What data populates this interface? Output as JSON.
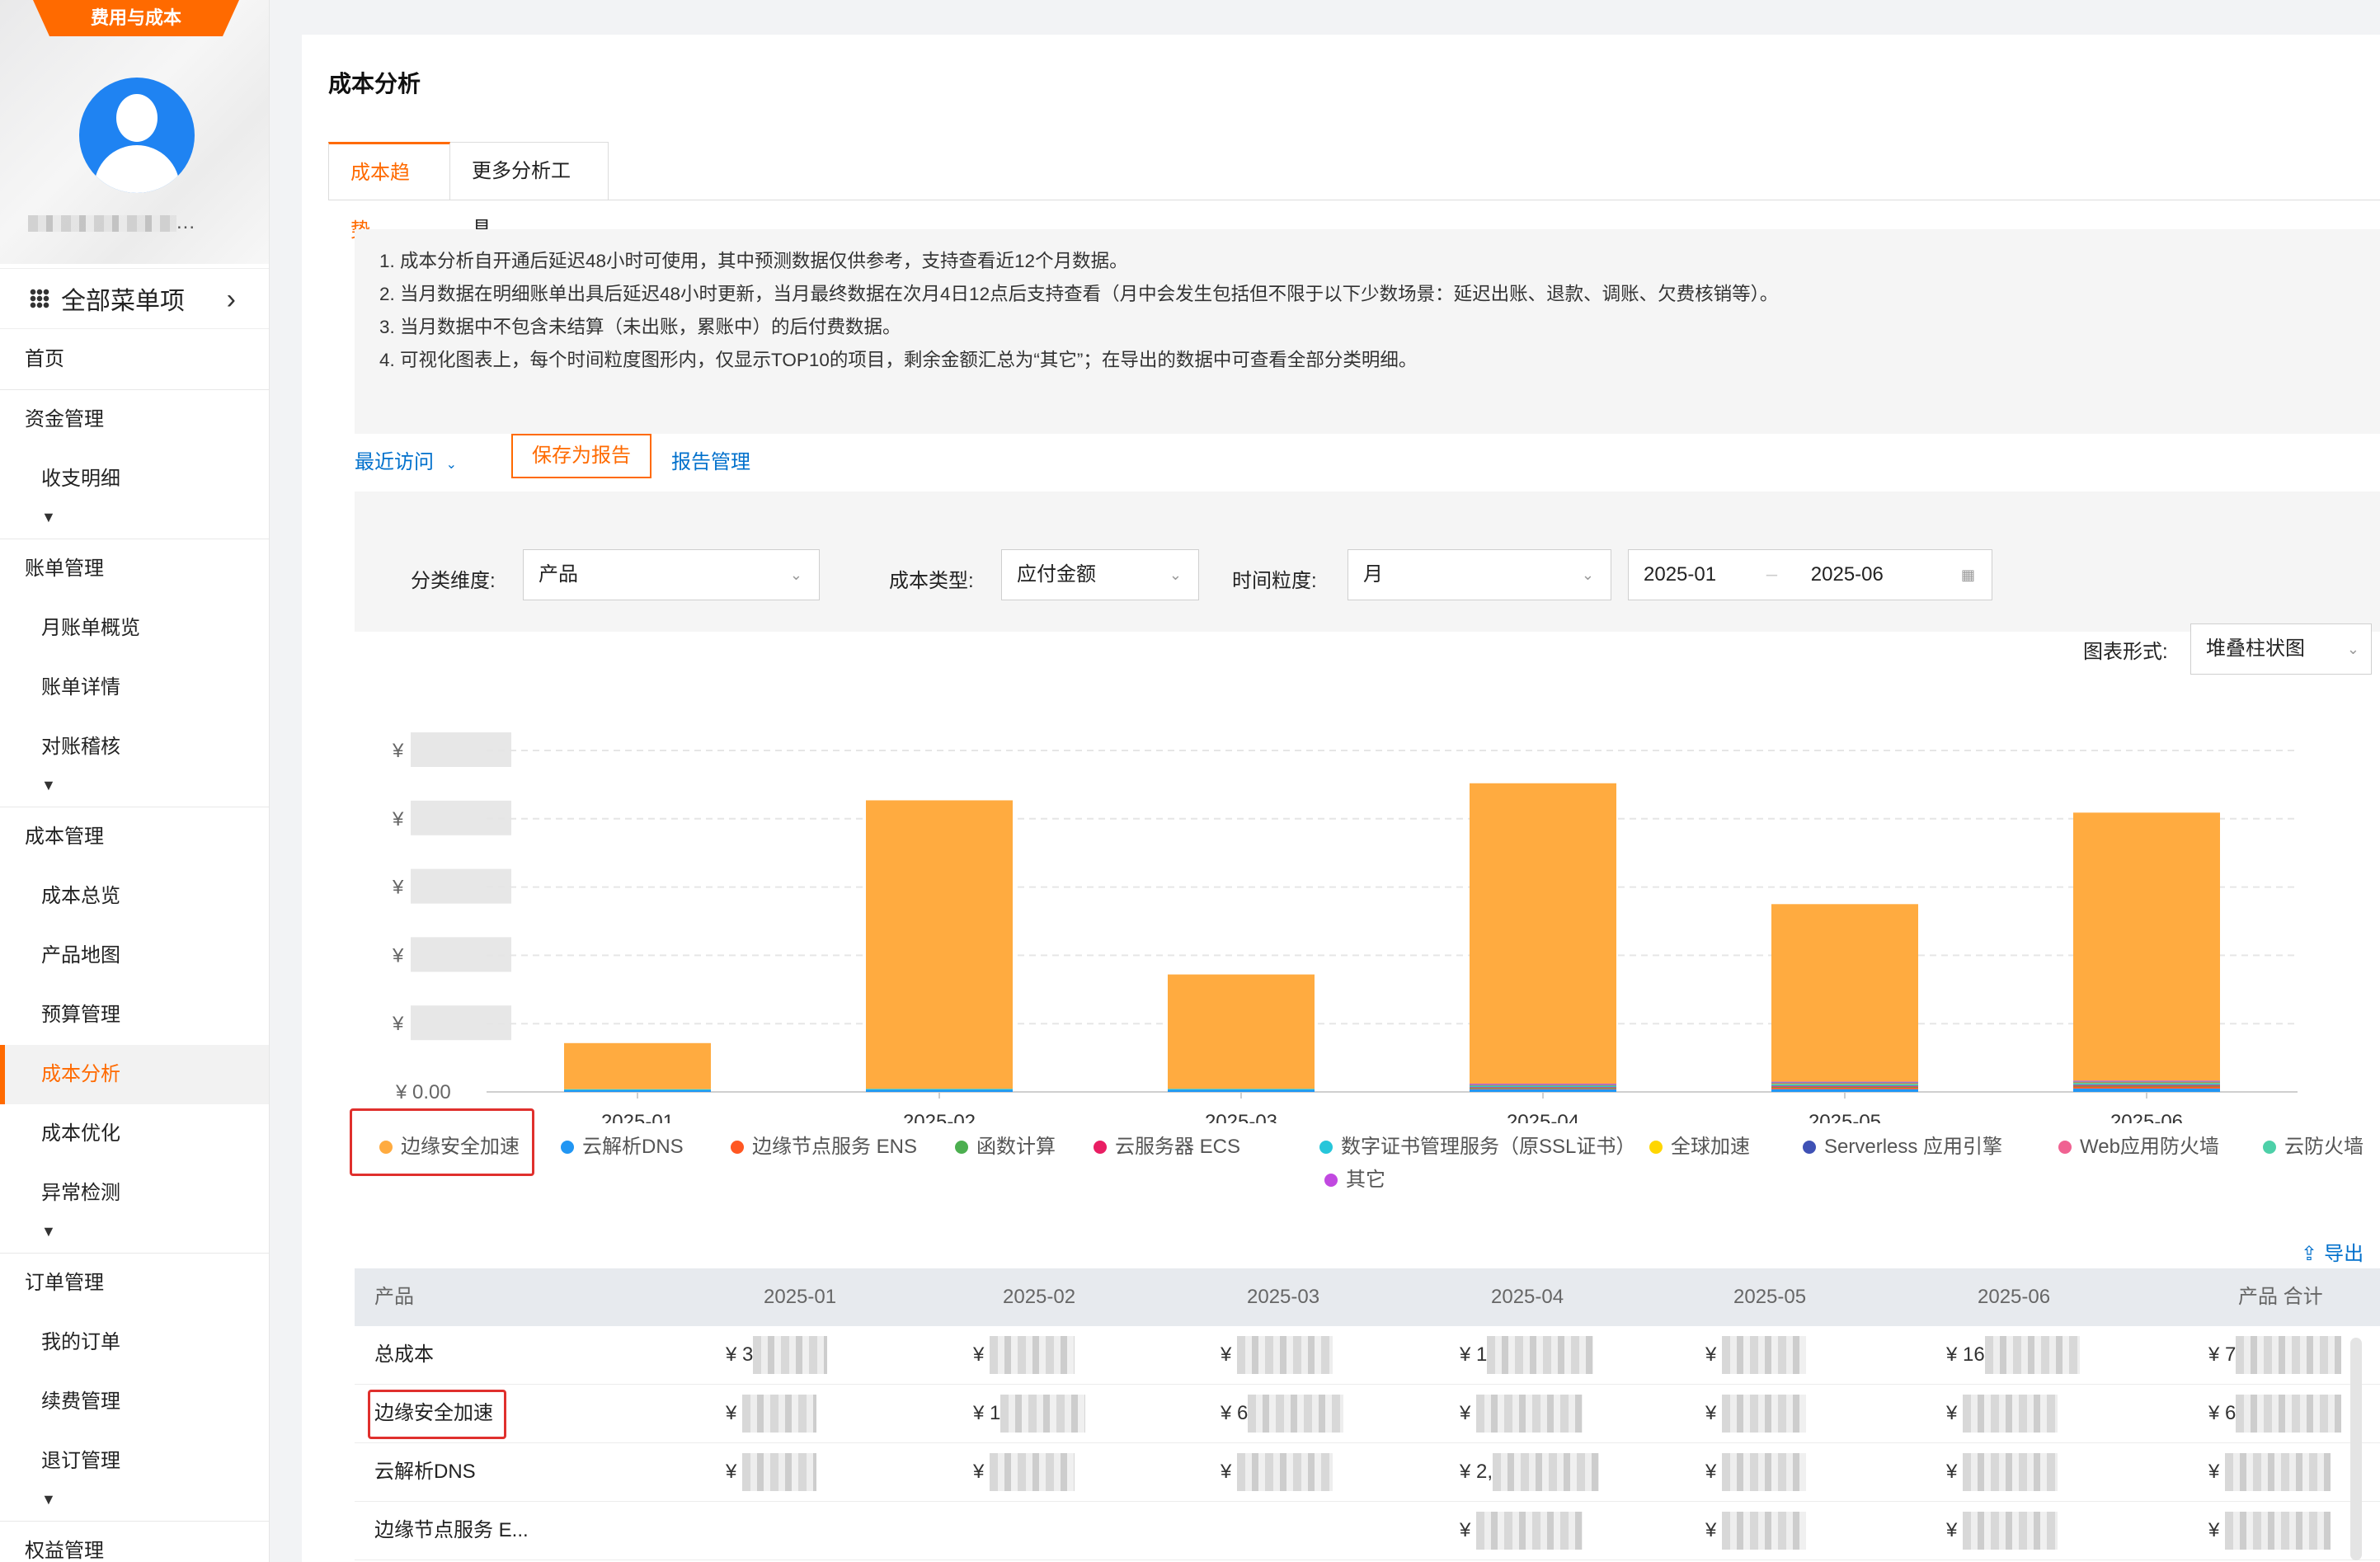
{
  "sidebar": {
    "tag": "费用与成本",
    "user_name": "...",
    "all_menu": "全部菜单项",
    "items": [
      {
        "label": "首页",
        "type": "group"
      },
      {
        "label": "资金管理",
        "type": "group"
      },
      {
        "label": "收支明细",
        "type": "sub"
      },
      {
        "label": "账单管理",
        "type": "group"
      },
      {
        "label": "月账单概览",
        "type": "sub"
      },
      {
        "label": "账单详情",
        "type": "sub"
      },
      {
        "label": "对账稽核",
        "type": "sub"
      },
      {
        "label": "成本管理",
        "type": "group"
      },
      {
        "label": "成本总览",
        "type": "sub"
      },
      {
        "label": "产品地图",
        "type": "sub"
      },
      {
        "label": "预算管理",
        "type": "sub"
      },
      {
        "label": "成本分析",
        "type": "sub",
        "active": true
      },
      {
        "label": "成本优化",
        "type": "sub"
      },
      {
        "label": "异常检测",
        "type": "sub"
      },
      {
        "label": "订单管理",
        "type": "group"
      },
      {
        "label": "我的订单",
        "type": "sub"
      },
      {
        "label": "续费管理",
        "type": "sub"
      },
      {
        "label": "退订管理",
        "type": "sub"
      },
      {
        "label": "权益管理",
        "type": "group"
      }
    ]
  },
  "main": {
    "title": "成本分析",
    "tabs": [
      "成本趋势",
      "更多分析工具"
    ],
    "notices": [
      "1. 成本分析自开通后延迟48小时可使用，其中预测数据仅供参考，支持查看近12个月数据。",
      "2. 当月数据在明细账单出具后延迟48小时更新，当月最终数据在次月4日12点后支持查看（月中会发生包括但不限于以下少数场景：延迟出账、退款、调账、欠费核销等）。",
      "3. 当月数据中不包含未结算（未出账，累账中）的后付费数据。",
      "4. 可视化图表上，每个时间粒度图形内，仅显示TOP10的项目，剩余金额汇总为“其它”；在导出的数据中可查看全部分类明细。"
    ],
    "recent": "最近访问",
    "save_report": "保存为报告",
    "report_mgr": "报告管理",
    "filters": {
      "dimension_label": "分类维度:",
      "dimension_value": "产品",
      "cost_type_label": "成本类型:",
      "cost_type_value": "应付金额",
      "granularity_label": "时间粒度:",
      "granularity_value": "月",
      "date_start": "2025-01",
      "date_sep": "–",
      "date_end": "2025-06"
    },
    "chart_type_label": "图表形式:",
    "chart_type_value": "堆叠柱状图",
    "export": "导出",
    "table": {
      "headers": [
        "产品",
        "2025-01",
        "2025-02",
        "2025-03",
        "2025-04",
        "2025-05",
        "2025-06",
        "产品 合计"
      ],
      "rows": [
        {
          "name": "总成本",
          "prefix": [
            "¥ 3",
            "¥ ",
            "¥ ",
            "¥ 1",
            "¥ ",
            "¥ 16",
            "¥ 7"
          ]
        },
        {
          "name": "边缘安全加速",
          "prefix": [
            "¥ ",
            "¥ 1",
            "¥ 6",
            "¥ ",
            "¥ ",
            "¥ ",
            "¥ 6"
          ]
        },
        {
          "name": "云解析DNS",
          "prefix": [
            "¥ ",
            "¥ ",
            "¥ ",
            "¥ 2,",
            "¥ ",
            "¥ ",
            "¥ "
          ]
        },
        {
          "name": "边缘节点服务 E...",
          "prefix": [
            "",
            "",
            "",
            "¥ ",
            "¥ ",
            "¥ ",
            "¥ "
          ]
        }
      ]
    }
  },
  "chart_data": {
    "type": "bar",
    "stacked": true,
    "categories": [
      "2025-01",
      "2025-02",
      "2025-03",
      "2025-04",
      "2025-05",
      "2025-06"
    ],
    "ylim": [
      0,
      100
    ],
    "y_zero_label": "¥ 0.00",
    "y_tick_prefix": "¥",
    "series": [
      {
        "name": "边缘安全加速",
        "color": "#ffab40",
        "values": [
          13.5,
          84.5,
          33.5,
          88,
          52,
          78.5
        ]
      },
      {
        "name": "云解析DNS",
        "color": "#2196f3",
        "values": [
          0.5,
          0.6,
          0.6,
          0.8,
          0.8,
          1.0
        ]
      },
      {
        "name": "边缘节点服务 ENS",
        "color": "#ff5722",
        "values": [
          0,
          0,
          0,
          0.3,
          0.6,
          0.7
        ]
      },
      {
        "name": "函数计算",
        "color": "#4caf50",
        "values": [
          0,
          0,
          0,
          0.1,
          0.1,
          0.1
        ]
      },
      {
        "name": "云服务器 ECS",
        "color": "#e91e63",
        "values": [
          0,
          0,
          0,
          0.2,
          0.3,
          0.3
        ]
      },
      {
        "name": "数字证书管理服务（原SSL证书）",
        "color": "#26c6da",
        "values": [
          0.3,
          0.3,
          0.3,
          0.5,
          0.6,
          0.6
        ]
      },
      {
        "name": "全球加速",
        "color": "#ffd600",
        "values": [
          0,
          0,
          0,
          0.1,
          0.1,
          0.1
        ]
      },
      {
        "name": "Serverless 应用引擎",
        "color": "#3f51b5",
        "values": [
          0,
          0,
          0,
          0.1,
          0.2,
          0.2
        ]
      },
      {
        "name": "Web应用防火墙",
        "color": "#f06292",
        "values": [
          0,
          0,
          0,
          0.1,
          0.1,
          0.1
        ]
      },
      {
        "name": "云防火墙",
        "color": "#4dd0a8",
        "values": [
          0,
          0,
          0,
          0.1,
          0.1,
          0.1
        ]
      },
      {
        "name": "其它",
        "color": "#c149e0",
        "values": [
          0,
          0,
          0,
          0.1,
          0.1,
          0.1
        ]
      }
    ]
  },
  "colors": {
    "accent": "#ff6a00",
    "link": "#0070cc",
    "highlight": "#e0302d"
  }
}
